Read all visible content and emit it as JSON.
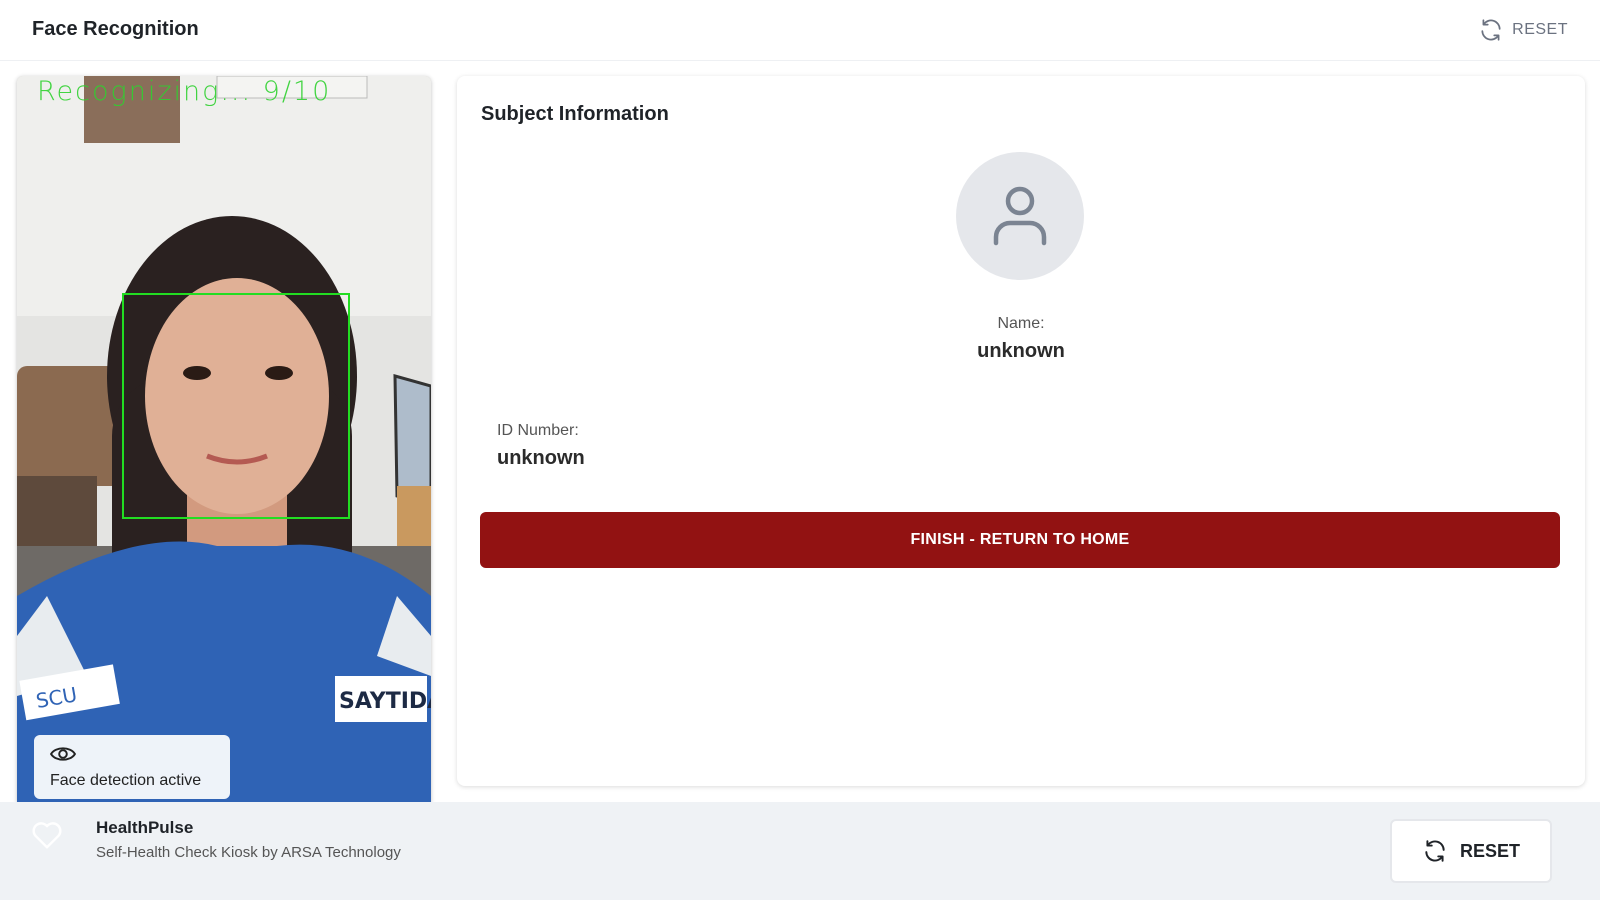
{
  "header": {
    "title": "Face Recognition",
    "reset_label": "RESET"
  },
  "camera": {
    "status_overlay": "Recognizing... 9/10",
    "detection_badge": "Face detection active",
    "shirt_patch_text": "SAYTIDAR",
    "logo_text": "SCU"
  },
  "subject": {
    "title": "Subject Information",
    "name_label": "Name:",
    "name_value": "unknown",
    "id_label": "ID Number:",
    "id_value": "unknown",
    "finish_button": "FINISH - RETURN TO HOME"
  },
  "footer": {
    "brand": "HealthPulse",
    "tagline": "Self-Health Check Kiosk by ARSA Technology",
    "reset_label": "RESET"
  },
  "colors": {
    "primary_red": "#921212",
    "detection_green": "#22dd22"
  },
  "icons": {
    "reset": "refresh-icon",
    "eye": "eye-icon",
    "avatar": "user-icon",
    "heart": "heart-icon"
  }
}
